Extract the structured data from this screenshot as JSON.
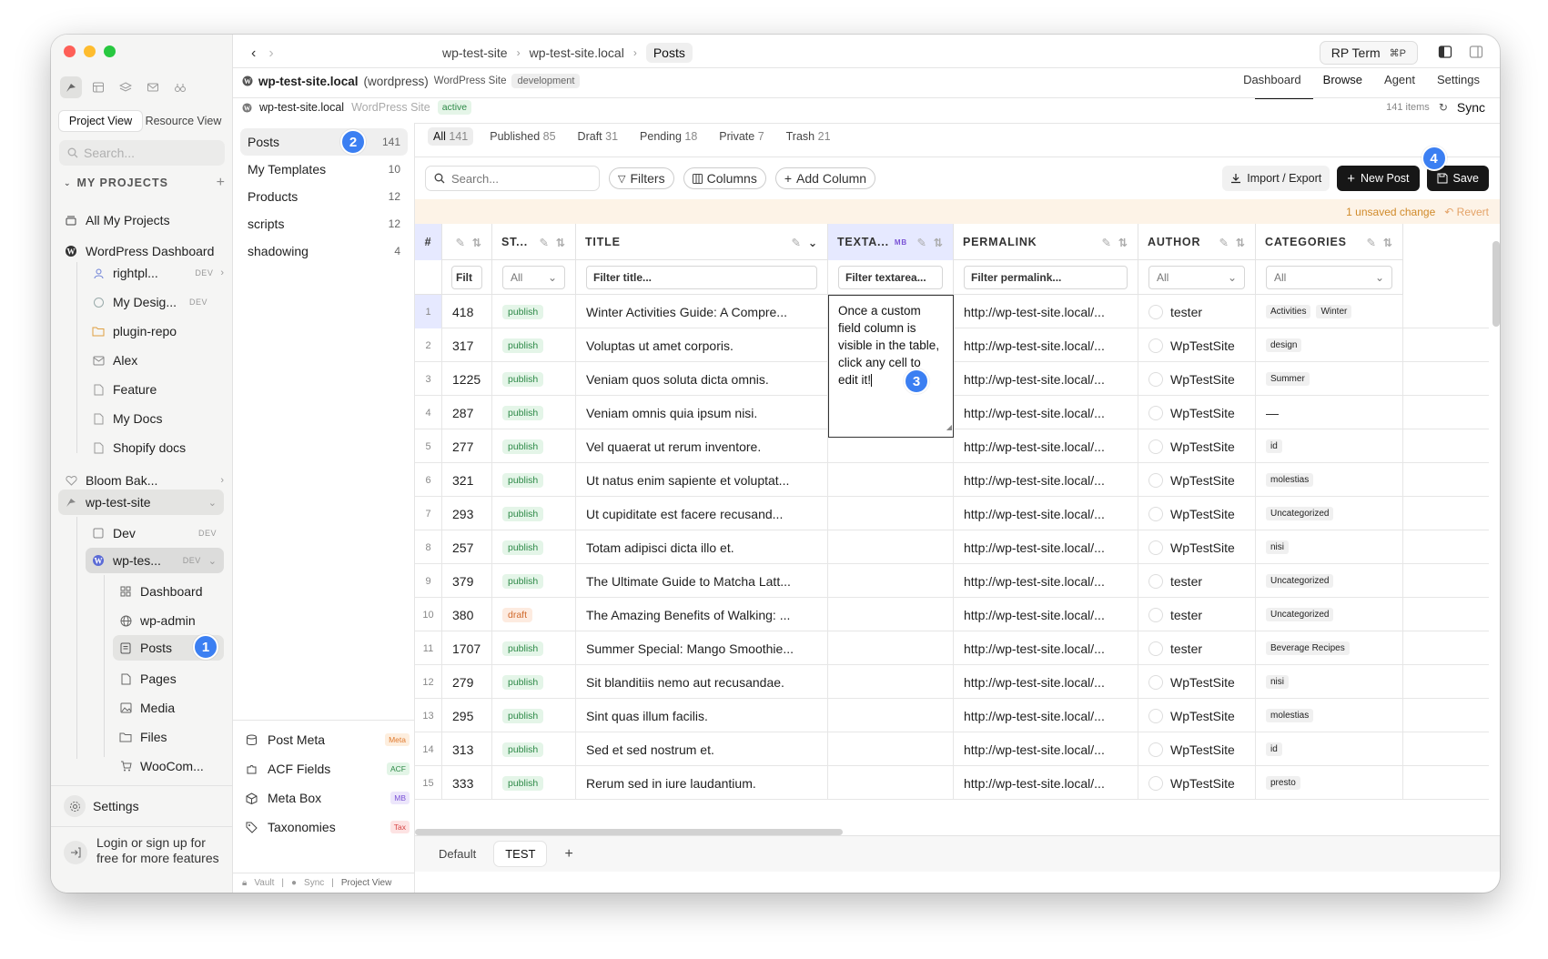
{
  "window": {
    "breadcrumbs": [
      "wp-test-site",
      "wp-test-site.local",
      "Posts"
    ],
    "term_button": {
      "label": "RP Term",
      "shortcut": "⌘P"
    }
  },
  "sidebar": {
    "view_toggle": [
      "Project View",
      "Resource View"
    ],
    "search_placeholder": "Search...",
    "section_title": "MY PROJECTS",
    "items": [
      {
        "label": "All My Projects"
      },
      {
        "label": "WordPress Dashboard"
      },
      {
        "label": "rightpl...",
        "tag": "DEV"
      },
      {
        "label": "My Desig...",
        "tag": "DEV"
      },
      {
        "label": "plugin-repo"
      },
      {
        "label": "Alex"
      },
      {
        "label": "Feature"
      },
      {
        "label": "My Docs"
      },
      {
        "label": "Shopify docs"
      },
      {
        "label": "Bloom Bak..."
      },
      {
        "label": "wp-test-site"
      },
      {
        "label": "Dev",
        "tag": "DEV"
      },
      {
        "label": "wp-tes...",
        "tag": "DEV"
      },
      {
        "label": "Dashboard"
      },
      {
        "label": "wp-admin"
      },
      {
        "label": "Posts"
      },
      {
        "label": "Pages"
      },
      {
        "label": "Media"
      },
      {
        "label": "Files"
      },
      {
        "label": "WooCom..."
      }
    ],
    "settings_label": "Settings",
    "login_text": "Login or sign up for free for more features"
  },
  "site": {
    "name": "wp-test-site.local",
    "type_paren": "(wordpress)",
    "kind": "WordPress Site",
    "env": "development",
    "sub_name": "wp-test-site.local",
    "sub_kind": "WordPress Site",
    "sub_status": "active",
    "items_count": "141 items",
    "sync_label": "Sync"
  },
  "nav_tabs": [
    "Dashboard",
    "Browse",
    "Agent",
    "Settings"
  ],
  "collections": [
    {
      "label": "Posts",
      "count": "141"
    },
    {
      "label": "My Templates",
      "count": "10"
    },
    {
      "label": "Products",
      "count": "12"
    },
    {
      "label": "scripts",
      "count": "12"
    },
    {
      "label": "shadowing",
      "count": "4"
    }
  ],
  "meta_items": [
    {
      "label": "Post Meta",
      "tag": "Meta",
      "tag_bg": "#fdeede",
      "tag_color": "#e07a2f"
    },
    {
      "label": "ACF Fields",
      "tag": "ACF",
      "tag_bg": "#e3f5e7",
      "tag_color": "#2e8a48"
    },
    {
      "label": "Meta Box",
      "tag": "MB",
      "tag_bg": "#ece6fb",
      "tag_color": "#7a52d6"
    },
    {
      "label": "Taxonomies",
      "tag": "Tax",
      "tag_bg": "#fde3e3",
      "tag_color": "#d64545"
    }
  ],
  "statusbar": {
    "vault": "Vault",
    "sync": "Sync",
    "view": "Project View"
  },
  "status_tabs": [
    {
      "label": "All",
      "count": "141"
    },
    {
      "label": "Published",
      "count": "85"
    },
    {
      "label": "Draft",
      "count": "31"
    },
    {
      "label": "Pending",
      "count": "18"
    },
    {
      "label": "Private",
      "count": "7"
    },
    {
      "label": "Trash",
      "count": "21"
    }
  ],
  "toolbar": {
    "search_placeholder": "Search...",
    "filters": "Filters",
    "columns": "Columns",
    "add_column": "Add Column",
    "import_export": "Import / Export",
    "new_post": "New Post",
    "save": "Save"
  },
  "unsaved": {
    "text": "1 unsaved change",
    "revert": "Revert"
  },
  "columns": {
    "num": "#",
    "status": "ST...",
    "title": "TITLE",
    "textarea": "TEXTA...",
    "textarea_tag": "MB",
    "permalink": "PERMALINK",
    "author": "AUTHOR",
    "categories": "CATEGORIES"
  },
  "filters": {
    "id": "Filt",
    "status": "All",
    "title": "Filter title...",
    "textarea": "Filter textarea...",
    "permalink": "Filter permalink...",
    "author": "All",
    "categories": "All"
  },
  "rows": [
    {
      "n": "1",
      "id": "418",
      "status": "publish",
      "title": "Winter Activities Guide: A Compre...",
      "permalink": "http://wp-test-site.local/...",
      "author": "tester",
      "cats": [
        "Activities",
        "Winter"
      ]
    },
    {
      "n": "2",
      "id": "317",
      "status": "publish",
      "title": "Voluptas ut amet corporis.",
      "permalink": "http://wp-test-site.local/...",
      "author": "WpTestSite",
      "cats": [
        "design"
      ]
    },
    {
      "n": "3",
      "id": "1225",
      "status": "publish",
      "title": "Veniam quos soluta dicta omnis.",
      "permalink": "http://wp-test-site.local/...",
      "author": "WpTestSite",
      "cats": [
        "Summer"
      ]
    },
    {
      "n": "4",
      "id": "287",
      "status": "publish",
      "title": "Veniam omnis quia ipsum nisi.",
      "permalink": "http://wp-test-site.local/...",
      "author": "WpTestSite",
      "cats": [],
      "cat_text": "—"
    },
    {
      "n": "5",
      "id": "277",
      "status": "publish",
      "title": "Vel quaerat ut rerum inventore.",
      "permalink": "http://wp-test-site.local/...",
      "author": "WpTestSite",
      "cats": [
        "id"
      ]
    },
    {
      "n": "6",
      "id": "321",
      "status": "publish",
      "title": "Ut natus enim sapiente et voluptat...",
      "permalink": "http://wp-test-site.local/...",
      "author": "WpTestSite",
      "cats": [
        "molestias"
      ]
    },
    {
      "n": "7",
      "id": "293",
      "status": "publish",
      "title": "Ut cupiditate est facere recusand...",
      "permalink": "http://wp-test-site.local/...",
      "author": "WpTestSite",
      "cats": [
        "Uncategorized"
      ]
    },
    {
      "n": "8",
      "id": "257",
      "status": "publish",
      "title": "Totam adipisci dicta illo et.",
      "permalink": "http://wp-test-site.local/...",
      "author": "WpTestSite",
      "cats": [
        "nisi"
      ]
    },
    {
      "n": "9",
      "id": "379",
      "status": "publish",
      "title": "The Ultimate Guide to Matcha Latt...",
      "permalink": "http://wp-test-site.local/...",
      "author": "tester",
      "cats": [
        "Uncategorized"
      ]
    },
    {
      "n": "10",
      "id": "380",
      "status": "draft",
      "title": "The Amazing Benefits of Walking: ...",
      "permalink": "http://wp-test-site.local/...",
      "author": "tester",
      "cats": [
        "Uncategorized"
      ]
    },
    {
      "n": "11",
      "id": "1707",
      "status": "publish",
      "title": "Summer Special: Mango Smoothie...",
      "permalink": "http://wp-test-site.local/...",
      "author": "tester",
      "cats": [
        "Beverage Recipes"
      ]
    },
    {
      "n": "12",
      "id": "279",
      "status": "publish",
      "title": "Sit blanditiis nemo aut recusandae.",
      "permalink": "http://wp-test-site.local/...",
      "author": "WpTestSite",
      "cats": [
        "nisi"
      ]
    },
    {
      "n": "13",
      "id": "295",
      "status": "publish",
      "title": "Sint quas illum facilis.",
      "permalink": "http://wp-test-site.local/...",
      "author": "WpTestSite",
      "cats": [
        "molestias"
      ]
    },
    {
      "n": "14",
      "id": "313",
      "status": "publish",
      "title": "Sed et sed nostrum et.",
      "permalink": "http://wp-test-site.local/...",
      "author": "WpTestSite",
      "cats": [
        "id"
      ]
    },
    {
      "n": "15",
      "id": "333",
      "status": "publish",
      "title": "Rerum sed in iure laudantium.",
      "permalink": "http://wp-test-site.local/...",
      "author": "WpTestSite",
      "cats": [
        "presto"
      ]
    }
  ],
  "editor_text": "Once a custom field column is visible in the table, click any cell to edit it!",
  "view_tabs": [
    "Default",
    "TEST"
  ],
  "steps": [
    "1",
    "2",
    "3",
    "4"
  ],
  "colors": {
    "accent": "#3b7ff2",
    "highlight": "#e6e9ff",
    "publish": "#2e8a48",
    "draft": "#d0692c"
  }
}
